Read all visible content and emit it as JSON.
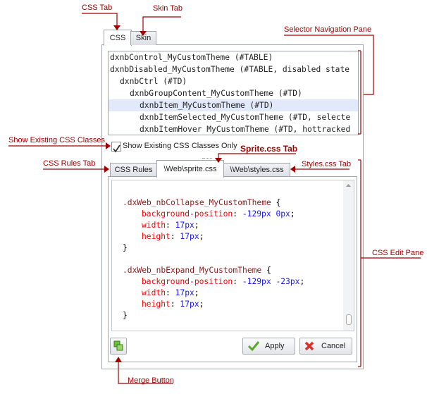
{
  "annotations": {
    "css_tab": "CSS Tab",
    "skin_tab": "Skin Tab",
    "selector_pane": "Selector Navigation Pane",
    "show_existing": "Show Existing CSS Classes",
    "sprite_tab": "Sprite.css Tab",
    "css_rules_tab": "CSS Rules Tab",
    "styles_tab": "Styles.css Tab",
    "edit_pane": "CSS Edit Pane",
    "merge_button": "Merge Button"
  },
  "top_tabs": [
    {
      "label": "CSS",
      "active": true
    },
    {
      "label": "Skin",
      "active": false
    }
  ],
  "selectors": [
    {
      "text": "dxnbControl_MyCustomTheme (#TABLE)",
      "level": 0,
      "selected": false
    },
    {
      "text": "dxnbDisabled_MyCustomTheme (#TABLE, disabled state",
      "level": 0,
      "selected": false
    },
    {
      "text": "dxnbCtrl (#TD)",
      "level": 1,
      "selected": false
    },
    {
      "text": "dxnbGroupContent_MyCustomTheme (#TD)",
      "level": 2,
      "selected": false
    },
    {
      "text": "dxnbItem_MyCustomTheme (#TD)",
      "level": 3,
      "selected": true
    },
    {
      "text": "dxnbItemSelected_MyCustomTheme (#TD, selecte",
      "level": 3,
      "selected": false
    },
    {
      "text": "dxnbItemHover MyCustomTheme (#TD, hottracked",
      "level": 3,
      "selected": false
    }
  ],
  "checkbox": {
    "label": "Show Existing CSS Classes Only",
    "checked": true
  },
  "file_tabs": [
    {
      "label": "CSS Rules",
      "active": false
    },
    {
      "label": "\\Web\\sprite.css",
      "active": true
    },
    {
      "label": "\\Web\\styles.css",
      "active": false
    }
  ],
  "code": {
    "rule1_selector": ".dxWeb_nbCollapse_MyCustomTheme",
    "rule1_bgpos": "-129px 0px",
    "rule2_selector": ".dxWeb_nbExpand_MyCustomTheme",
    "rule2_bgpos": "-129px -23px",
    "prop_bgpos": "background-position",
    "prop_width": "width",
    "prop_height": "height",
    "size": "17px",
    "open": "{",
    "close": "}"
  },
  "buttons": {
    "apply": "Apply",
    "cancel": "Cancel"
  },
  "colors": {
    "annotation": "#a00000",
    "selector": "#8b1a1a",
    "property": "#ff0000",
    "value": "#1414ff",
    "selection": "#e1e9fb"
  }
}
